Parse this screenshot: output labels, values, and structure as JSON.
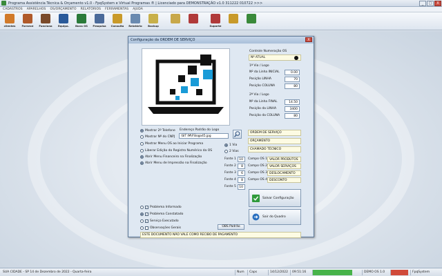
{
  "window": {
    "title": "Programa Assistência Técnica & Orçamento v1.0 - FpqSystem e Virtual Programas ® | Licenciado para  DEMONSTRAÇÃO v1.0 311222 010722 >>>",
    "buttons": {
      "minimize": "_",
      "maximize": "□",
      "close": "X"
    }
  },
  "menu": [
    "CADASTROS",
    "APARELHOS",
    "OS/ORÇAMENTO",
    "RELATÓRIOS",
    "FERRAMENTAS",
    "AJUDA"
  ],
  "toolbar": [
    {
      "label": "clientes",
      "icon": "people-icon",
      "color": "#d17a2a"
    },
    {
      "label": "Fornece",
      "icon": "supplier-icon",
      "color": "#b05a2a"
    },
    {
      "label": "Funciona",
      "icon": "employee-icon",
      "color": "#7a4a2a"
    },
    {
      "label": "Equipa.",
      "icon": "equipment-icon",
      "color": "#2a5a9a"
    },
    {
      "label": "Nova OS",
      "icon": "new-order-icon",
      "color": "#2a7a3a"
    },
    {
      "label": "Pesquisa",
      "icon": "search-icon",
      "color": "#4a6a9a"
    },
    {
      "label": "Consulta",
      "icon": "envelope-icon",
      "color": "#c99a2a"
    },
    {
      "label": "Relatório",
      "icon": "report-icon",
      "color": "#6a8ab0"
    },
    {
      "label": "Backup",
      "icon": "backup-icon",
      "color": "#c8b04a"
    },
    {
      "label": "",
      "icon": "calculator-icon",
      "color": "#c8a84a"
    },
    {
      "label": "",
      "icon": "book-icon",
      "color": "#b03a3a"
    },
    {
      "label": "Suporte",
      "icon": "support-icon",
      "color": "#b03a3a"
    },
    {
      "label": "",
      "icon": "coins-icon",
      "color": "#c89a2a"
    },
    {
      "label": "",
      "icon": "exit-icon",
      "color": "#3a8a3a"
    }
  ],
  "dialog": {
    "title": "Configuração da ORDEM DE SERVIÇO",
    "close": "X",
    "numbering": {
      "heading": "Controle Numeração OS",
      "current_label": "Nº ATUAL",
      "via1_heading": "1ª Via / Logo",
      "via1_fields": [
        {
          "label": "Nº da Linha INICIAL",
          "value": "0.00"
        },
        {
          "label": "Posição LINHA",
          "value": "70"
        },
        {
          "label": "Posição COLUNA",
          "value": "80"
        }
      ],
      "via2_heading": "2ª Via / Logo",
      "via2_fields": [
        {
          "label": "Nº da Linha FINAL",
          "value": "14.50"
        },
        {
          "label": "Posição da LINHA",
          "value": "3400"
        },
        {
          "label": "Posição da COLUNA",
          "value": "80"
        }
      ]
    },
    "logo_path_label": "Endereço Padrão do Logo",
    "logo_path_value": "\\SIT IM\\FSlogo45.jpg",
    "vias": [
      {
        "label": "1 Via",
        "selected": true
      },
      {
        "label": "2 Vias",
        "selected": false
      }
    ],
    "options": [
      {
        "label": "Mostrar 2º Telefone",
        "selected": true
      },
      {
        "label": "Mostrar Nº do CNPJ",
        "selected": false
      },
      {
        "label": "Mostrar Menu OS ao Iniciar Programa",
        "selected": false
      },
      {
        "label": "Liberar Edição do Registro Numérico da OS",
        "selected": false
      },
      {
        "label": "Abrir Menu Financeiro na Finalização",
        "selected": true
      },
      {
        "label": "Abrir Menu de Impressão na Finalização",
        "selected": true
      }
    ],
    "fonts": [
      {
        "label": "Fonte 1",
        "value": "10"
      },
      {
        "label": "Fonte 2",
        "value": "8"
      },
      {
        "label": "Fonte 3",
        "value": "6"
      },
      {
        "label": "Fonte 4",
        "value": "8"
      },
      {
        "label": "Fonte 5",
        "value": "10"
      }
    ],
    "headers": [
      "ORDEM DE SERVIÇO",
      "ORÇAMENTO",
      "CHAMADO TÉCNICO"
    ],
    "campos": [
      {
        "label": "Campo OS 1",
        "value": "VALOR PRODUTOS"
      },
      {
        "label": "Campo OS 2",
        "value": "VALOR SERVIÇOS"
      },
      {
        "label": "Campo OS 3",
        "value": "DESLOCAMENTO"
      },
      {
        "label": "Campo OS 4",
        "value": "DESCONTO"
      }
    ],
    "save_button": "Salvar Configuração",
    "exit_button": "Sair do Quadro",
    "checks": [
      {
        "label": "Problema Informado",
        "checked": true
      },
      {
        "label": "Problema Constatado",
        "checked": true
      },
      {
        "label": "Serviço Executado",
        "checked": true
      },
      {
        "label": "Observações Gerais",
        "checked": false
      }
    ],
    "obs_button": "OBS Padrão",
    "footer_text": "ESTE DOCUMENTO NÃO VALE COMO RECIBO DE PAGAMENTO"
  },
  "status": {
    "city_date": "SUA CIDADE - SP 14 de Dezembro de 2022 - Quarta-feira",
    "num": "Num",
    "caps": "Caps",
    "date": "14/12/2022",
    "time": "09:51:16",
    "right_label": "DEMO OS 1.0",
    "brand": "FpqSystem"
  }
}
